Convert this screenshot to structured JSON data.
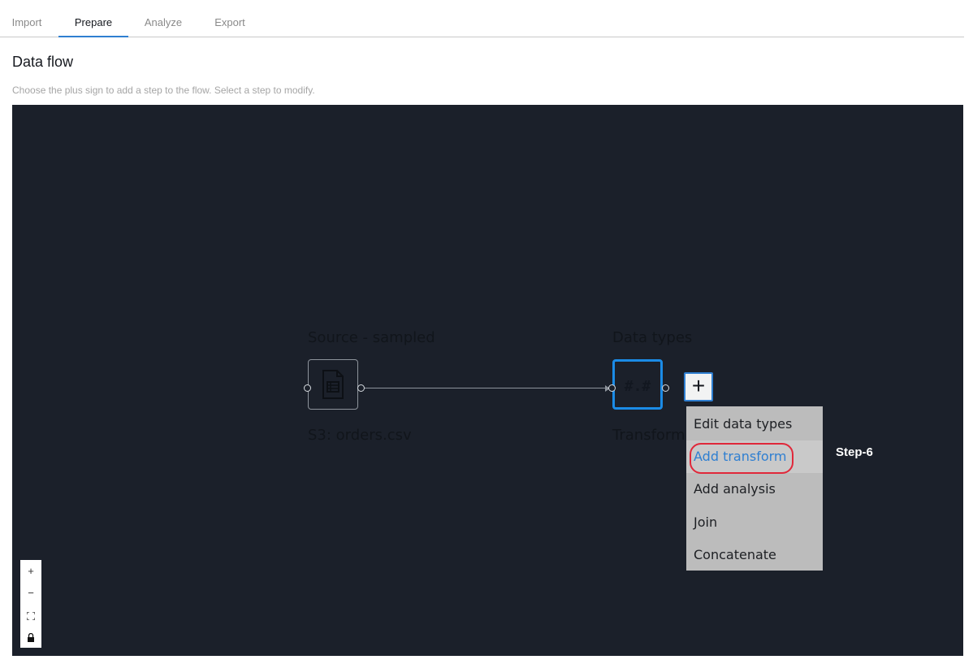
{
  "tabs": [
    {
      "label": "Import"
    },
    {
      "label": "Prepare",
      "active": true
    },
    {
      "label": "Analyze"
    },
    {
      "label": "Export"
    }
  ],
  "header": {
    "title": "Data flow",
    "subtitle": "Choose the plus sign to add a step to the flow. Select a step to modify."
  },
  "flow": {
    "source_node": {
      "title": "Source - sampled",
      "caption": "S3: orders.csv",
      "icon": "csv-file-icon"
    },
    "types_node": {
      "title": "Data types",
      "caption": "Transform",
      "glyph": "#.#",
      "icon": "data-types-icon"
    },
    "add_button_symbol": "+"
  },
  "context_menu": {
    "items": [
      {
        "label": "Edit data types"
      },
      {
        "label": "Add transform",
        "highlighted": true
      },
      {
        "label": "Add analysis"
      },
      {
        "label": "Join"
      },
      {
        "label": "Concatenate"
      }
    ]
  },
  "annotation": {
    "step_label": "Step-6",
    "ring_color": "#e0283a"
  },
  "zoom_controls": {
    "zoom_in": "+",
    "zoom_out": "−",
    "fit": "fit-view-icon",
    "lock": "lock-icon"
  },
  "colors": {
    "canvas": "#1b202a",
    "accent": "#2f7fd1",
    "selected_node_border": "#1b8be6",
    "menu_bg": "#bcbcbc"
  }
}
